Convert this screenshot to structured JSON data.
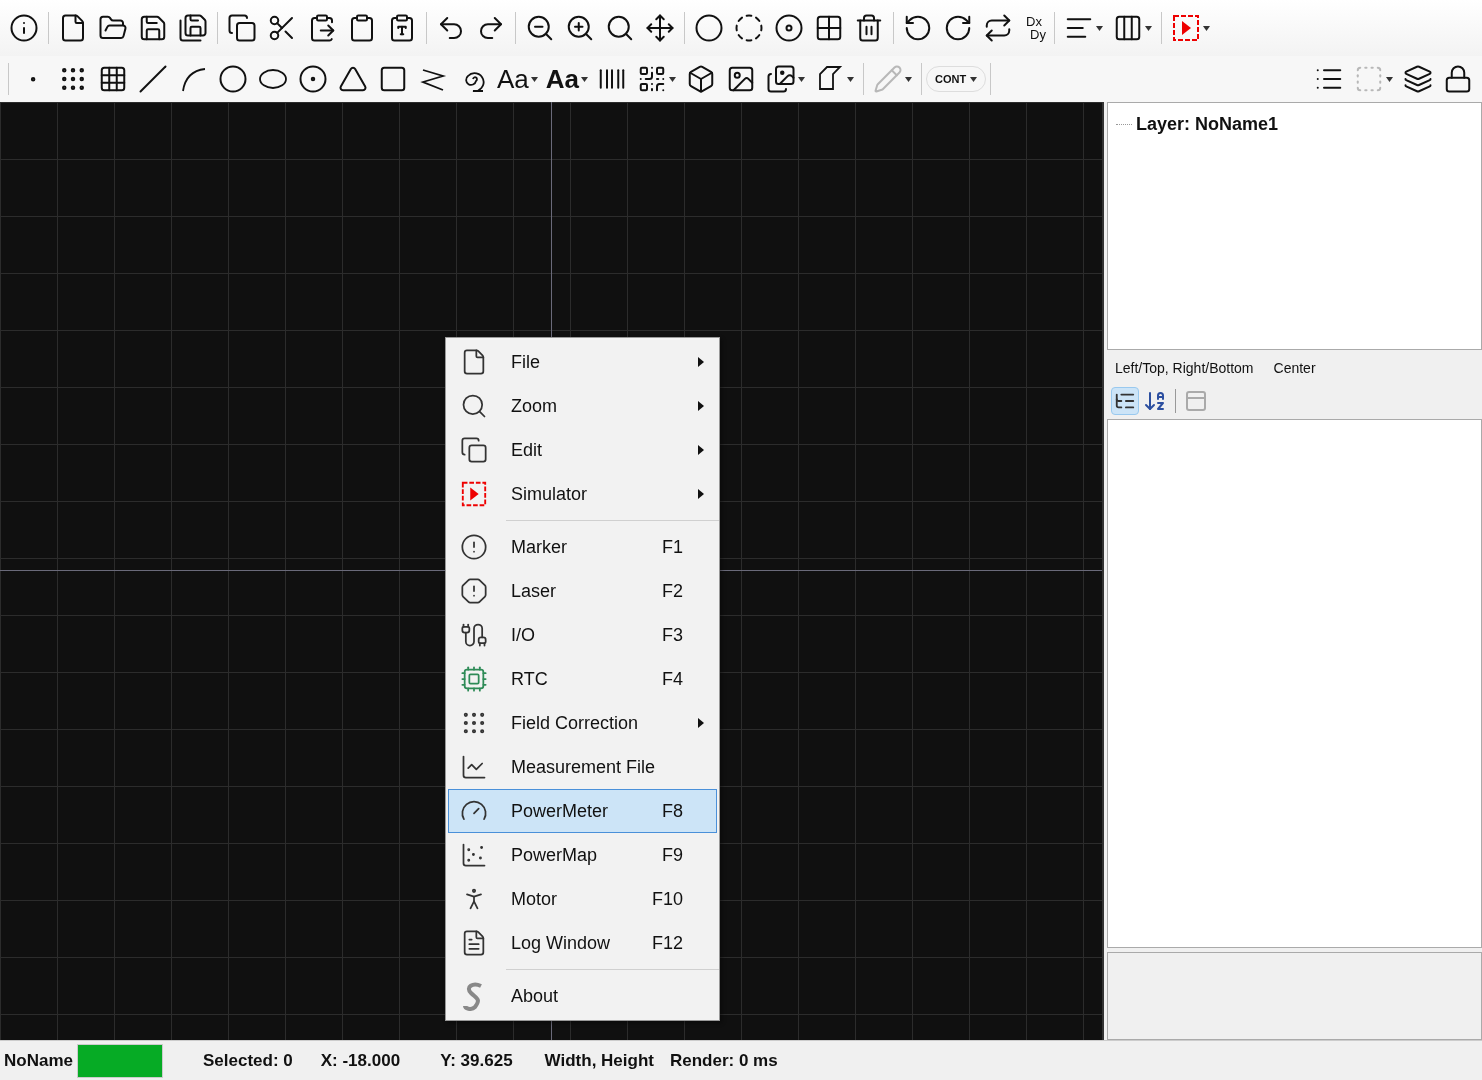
{
  "toolbar": {
    "dx": "Dx",
    "dy": "Dy",
    "font_button": "Aa",
    "bold_font_button": "Aa",
    "cont_button": "CONT"
  },
  "layer_tree": {
    "items": [
      {
        "label": "Layer: NoName1"
      }
    ]
  },
  "properties": {
    "tabs": [
      {
        "label": "Left/Top, Right/Bottom"
      },
      {
        "label": "Center"
      }
    ],
    "sort_categorized_selected": true
  },
  "context_menu": {
    "groups": [
      [
        {
          "label": "File",
          "submenu": true,
          "selected": false
        },
        {
          "label": "Zoom",
          "submenu": true,
          "selected": false
        },
        {
          "label": "Edit",
          "submenu": true,
          "selected": false
        },
        {
          "label": "Simulator",
          "submenu": true,
          "selected": false
        }
      ],
      [
        {
          "label": "Marker",
          "shortcut": "F1",
          "submenu": false,
          "selected": false
        },
        {
          "label": "Laser",
          "shortcut": "F2",
          "submenu": false,
          "selected": false
        },
        {
          "label": "I/O",
          "shortcut": "F3",
          "submenu": false,
          "selected": false
        },
        {
          "label": "RTC",
          "shortcut": "F4",
          "submenu": false,
          "selected": false
        },
        {
          "label": "Field Correction",
          "submenu": true,
          "selected": false
        },
        {
          "label": "Measurement File",
          "submenu": false,
          "selected": false
        },
        {
          "label": "PowerMeter",
          "shortcut": "F8",
          "submenu": false,
          "selected": true
        },
        {
          "label": "PowerMap",
          "shortcut": "F9",
          "submenu": false,
          "selected": false
        },
        {
          "label": "Motor",
          "shortcut": "F10",
          "submenu": false,
          "selected": false
        },
        {
          "label": "Log Window",
          "shortcut": "F12",
          "submenu": false,
          "selected": false
        }
      ],
      [
        {
          "label": "About",
          "submenu": false,
          "selected": false
        }
      ]
    ]
  },
  "status_bar": {
    "layer": "NoName",
    "selected": "Selected: 0",
    "x": "X: -18.000",
    "y": "Y: 39.625",
    "size": "Width, Height",
    "render": "Render: 0 ms"
  }
}
